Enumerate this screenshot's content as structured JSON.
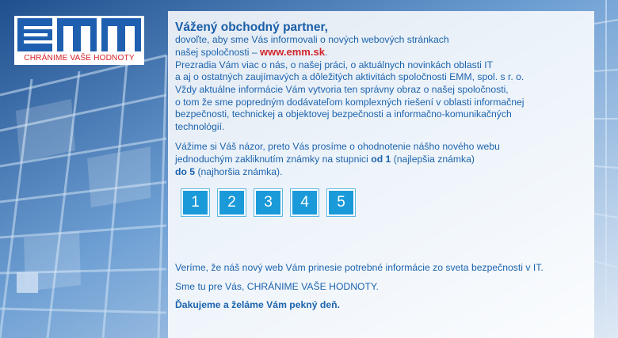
{
  "logo": {
    "text": "EMM",
    "tagline": "CHRÁNIME VAŠE HODNOTY"
  },
  "colors": {
    "brand_blue": "#1c63ad",
    "brand_red": "#d3252b",
    "button_blue": "#1a9ad9"
  },
  "message": {
    "title": "Vážený obchodný partner,",
    "intro_line1": "dovoľte, aby sme Vás informovali o nových webových stránkach",
    "intro_line2_prefix": "našej spoločnosti – ",
    "url": "www.emm.sk",
    "intro_line2_suffix": ".",
    "p1_line1": "Prezradia Vám viac o nás, o našej práci, o aktuálnych novinkách oblasti IT",
    "p1_line2": "a aj o ostatných zaujímavých a dôležitých aktivitách spoločnosti EMM, spol. s r. o.",
    "p1_line3": "Vždy aktuálne informácie Vám vytvoria ten správny obraz o našej spoločnosti,",
    "p1_line4": "o tom že sme popredným dodávateľom komplexných riešení v oblasti informačnej",
    "p1_line5": "bezpečnosti, technickej a objektovej bezpečnosti a informačno-komunikačných",
    "p1_line6": "technológií.",
    "p2_line1": "Vážime si Váš názor, preto Vás prosíme o ohodnotenie nášho nového webu",
    "p2_line2_prefix": "jednoduchým zakliknutím známky na stupnici ",
    "p2_od": "od 1",
    "p2_line2_suffix": " (najlepšia známka)",
    "p2_do": "do 5",
    "p2_line3_suffix": " (najhoršia známka)."
  },
  "rating": [
    "1",
    "2",
    "3",
    "4",
    "5"
  ],
  "closing": {
    "line1": "Veríme, že náš nový web Vám prinesie potrebné informácie zo sveta bezpečnosti v IT.",
    "line2": "Sme tu pre Vás, CHRÁNIME VAŠE HODNOTY.",
    "line3": "Ďakujeme a želáme Vám pekný deň."
  }
}
